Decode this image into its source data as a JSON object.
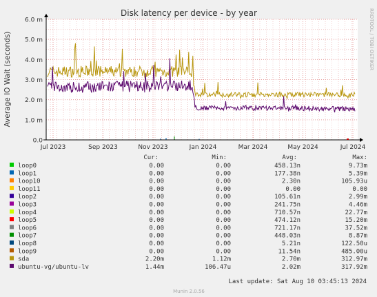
{
  "chart_data": {
    "type": "line",
    "title": "Disk latency per device - by year",
    "ylabel": "Average IO Wait (seconds)",
    "side_label": "RRDTOOL / TOBI OETIKER",
    "ylim": [
      0,
      6.0
    ],
    "y_unit": "seconds",
    "y_ticks": [
      {
        "value": 0,
        "label": "0.0"
      },
      {
        "value": 1.0,
        "label": "1.0 m"
      },
      {
        "value": 2.0,
        "label": "2.0 m"
      },
      {
        "value": 3.0,
        "label": "3.0 m"
      },
      {
        "value": 4.0,
        "label": "4.0 m"
      },
      {
        "value": 5.0,
        "label": "5.0 m"
      },
      {
        "value": 6.0,
        "label": "6.0 m"
      }
    ],
    "x_ticks": [
      "Jul 2023",
      "Sep 2023",
      "Nov 2023",
      "Jan 2024",
      "Mar 2024",
      "May 2024",
      "Jul 2024"
    ],
    "grid": true,
    "series_approx": [
      {
        "name": "sda",
        "color": "#b8960e",
        "profile": [
          [
            0,
            3.4
          ],
          [
            0.47,
            3.4
          ],
          [
            0.48,
            2.25
          ],
          [
            1.0,
            2.25
          ]
        ]
      },
      {
        "name": "ubuntu-vg/ubuntu-lv",
        "color": "#5c0a6e",
        "profile": [
          [
            0,
            2.6
          ],
          [
            0.47,
            2.7
          ],
          [
            0.48,
            1.6
          ],
          [
            1.0,
            1.55
          ]
        ]
      }
    ]
  },
  "legend": {
    "headers": {
      "cur": "Cur:",
      "min": "Min:",
      "avg": "Avg:",
      "max": "Max:"
    },
    "rows": [
      {
        "name": "loop0",
        "color": "#00cc00",
        "cur": "0.00",
        "min": "0.00",
        "avg": "458.13n",
        "max": "9.73m"
      },
      {
        "name": "loop1",
        "color": "#0066b3",
        "cur": "0.00",
        "min": "0.00",
        "avg": "177.38n",
        "max": "5.39m"
      },
      {
        "name": "loop10",
        "color": "#ff8000",
        "cur": "0.00",
        "min": "0.00",
        "avg": "2.30n",
        "max": "105.93u"
      },
      {
        "name": "loop11",
        "color": "#ffcc00",
        "cur": "0.00",
        "min": "0.00",
        "avg": "0.00",
        "max": "0.00"
      },
      {
        "name": "loop2",
        "color": "#330099",
        "cur": "0.00",
        "min": "0.00",
        "avg": "105.61n",
        "max": "2.99m"
      },
      {
        "name": "loop3",
        "color": "#990099",
        "cur": "0.00",
        "min": "0.00",
        "avg": "241.75n",
        "max": "4.46m"
      },
      {
        "name": "loop4",
        "color": "#ccff00",
        "cur": "0.00",
        "min": "0.00",
        "avg": "710.57n",
        "max": "22.77m"
      },
      {
        "name": "loop5",
        "color": "#ff0000",
        "cur": "0.00",
        "min": "0.00",
        "avg": "474.12n",
        "max": "15.20m"
      },
      {
        "name": "loop6",
        "color": "#808080",
        "cur": "0.00",
        "min": "0.00",
        "avg": "721.17n",
        "max": "37.52m"
      },
      {
        "name": "loop7",
        "color": "#008f00",
        "cur": "0.00",
        "min": "0.00",
        "avg": "448.03n",
        "max": "8.87m"
      },
      {
        "name": "loop8",
        "color": "#00487d",
        "cur": "0.00",
        "min": "0.00",
        "avg": "5.21n",
        "max": "122.50u"
      },
      {
        "name": "loop9",
        "color": "#b35a00",
        "cur": "0.00",
        "min": "0.00",
        "avg": "11.54n",
        "max": "485.00u"
      },
      {
        "name": "sda",
        "color": "#b8960e",
        "cur": "2.20m",
        "min": "1.12m",
        "avg": "2.70m",
        "max": "312.97m"
      },
      {
        "name": "ubuntu-vg/ubuntu-lv",
        "color": "#5c0a6e",
        "cur": "1.44m",
        "min": "106.47u",
        "avg": "2.02m",
        "max": "317.92m"
      }
    ]
  },
  "last_update": "Last update: Sat Aug 10 03:45:13 2024",
  "footer": "Munin 2.0.56"
}
